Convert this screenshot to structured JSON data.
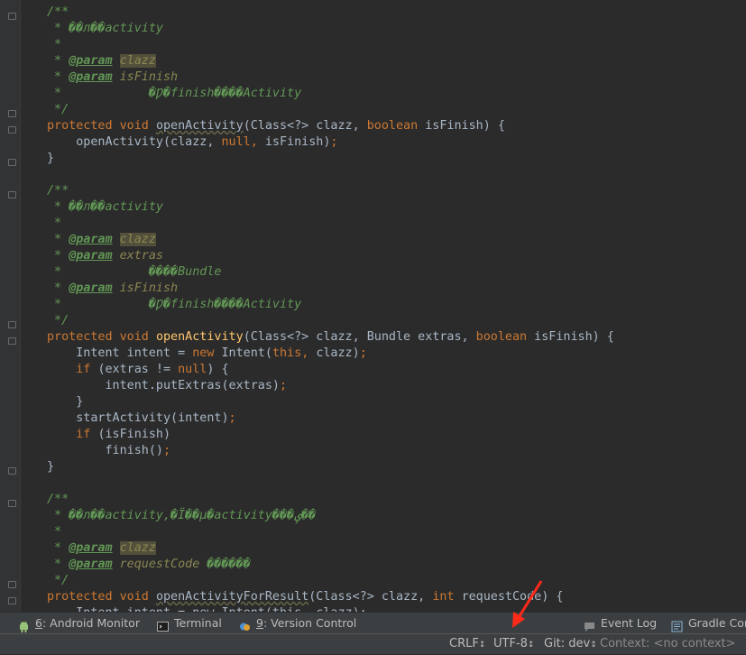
{
  "code_lines": [
    [
      [
        "doc",
        "/**"
      ]
    ],
    [
      [
        "doc",
        " * ��л��activity"
      ]
    ],
    [
      [
        "doc",
        " *"
      ]
    ],
    [
      [
        "doc",
        " * "
      ],
      [
        "tag",
        "@param"
      ],
      [
        "doc",
        " "
      ],
      [
        "hl",
        "clazz"
      ]
    ],
    [
      [
        "doc",
        " * "
      ],
      [
        "tag",
        "@param"
      ],
      [
        "doc",
        " "
      ],
      [
        "param",
        "isFinish"
      ]
    ],
    [
      [
        "doc",
        " *            �Ƿ�finish����Activity"
      ]
    ],
    [
      [
        "doc",
        " */"
      ]
    ],
    [
      [
        "kw",
        "protected void "
      ],
      [
        "fnu",
        "openActivity"
      ],
      [
        "txt",
        "(Class<?> clazz, "
      ],
      [
        "kw",
        "boolean "
      ],
      [
        "txt",
        "isFinish) {"
      ]
    ],
    [
      [
        "txt",
        "    openActivity(clazz, "
      ],
      [
        "kw",
        "null"
      ],
      [
        "punct",
        ", "
      ],
      [
        "txt",
        "isFinish)"
      ],
      [
        "punct",
        ";"
      ]
    ],
    [
      [
        "txt",
        "}"
      ]
    ],
    [
      [
        "txt",
        ""
      ]
    ],
    [
      [
        "doc",
        "/**"
      ]
    ],
    [
      [
        "doc",
        " * ��л��activity"
      ]
    ],
    [
      [
        "doc",
        " *"
      ]
    ],
    [
      [
        "doc",
        " * "
      ],
      [
        "tag",
        "@param"
      ],
      [
        "doc",
        " "
      ],
      [
        "hl",
        "clazz"
      ]
    ],
    [
      [
        "doc",
        " * "
      ],
      [
        "tag",
        "@param"
      ],
      [
        "doc",
        " "
      ],
      [
        "param",
        "extras"
      ]
    ],
    [
      [
        "doc",
        " *            ����Bundle"
      ]
    ],
    [
      [
        "doc",
        " * "
      ],
      [
        "tag",
        "@param"
      ],
      [
        "doc",
        " "
      ],
      [
        "param",
        "isFinish"
      ]
    ],
    [
      [
        "doc",
        " *            �Ƿ�finish����Activity"
      ]
    ],
    [
      [
        "doc",
        " */"
      ]
    ],
    [
      [
        "kw",
        "protected void "
      ],
      [
        "fn",
        "openActivity"
      ],
      [
        "txt",
        "(Class<?> clazz, Bundle extras, "
      ],
      [
        "kw",
        "boolean "
      ],
      [
        "txt",
        "isFinish) {"
      ]
    ],
    [
      [
        "txt",
        "    Intent intent = "
      ],
      [
        "kw",
        "new "
      ],
      [
        "txt",
        "Intent("
      ],
      [
        "kw",
        "this"
      ],
      [
        "punct",
        ", "
      ],
      [
        "txt",
        "clazz)"
      ],
      [
        "punct",
        ";"
      ]
    ],
    [
      [
        "txt",
        "    "
      ],
      [
        "kw",
        "if "
      ],
      [
        "txt",
        "(extras != "
      ],
      [
        "kw",
        "null"
      ],
      [
        "txt",
        ") {"
      ]
    ],
    [
      [
        "txt",
        "        intent.putExtras(extras)"
      ],
      [
        "punct",
        ";"
      ]
    ],
    [
      [
        "txt",
        "    }"
      ]
    ],
    [
      [
        "txt",
        "    startActivity(intent)"
      ],
      [
        "punct",
        ";"
      ]
    ],
    [
      [
        "txt",
        "    "
      ],
      [
        "kw",
        "if "
      ],
      [
        "txt",
        "(isFinish)"
      ]
    ],
    [
      [
        "txt",
        "        finish()"
      ],
      [
        "punct",
        ";"
      ]
    ],
    [
      [
        "txt",
        "}"
      ]
    ],
    [
      [
        "txt",
        ""
      ]
    ],
    [
      [
        "doc",
        "/**"
      ]
    ],
    [
      [
        "doc",
        " * ��л��activity,�Ϊ��µ�activity���ݷ��"
      ]
    ],
    [
      [
        "doc",
        " *"
      ]
    ],
    [
      [
        "doc",
        " * "
      ],
      [
        "tag",
        "@param"
      ],
      [
        "doc",
        " "
      ],
      [
        "hl",
        "clazz"
      ]
    ],
    [
      [
        "doc",
        " * "
      ],
      [
        "tag",
        "@param"
      ],
      [
        "doc",
        " "
      ],
      [
        "param",
        "requestCode"
      ],
      [
        "doc",
        " ������"
      ]
    ],
    [
      [
        "doc",
        " */"
      ]
    ],
    [
      [
        "kw",
        "protected void "
      ],
      [
        "fnu",
        "openActivityForResult"
      ],
      [
        "txt",
        "(Class<?> clazz, "
      ],
      [
        "kw",
        "int "
      ],
      [
        "txt",
        "requestCode) {"
      ]
    ],
    [
      [
        "txt",
        "    Intent intent = new Intent(this, clazz);"
      ]
    ]
  ],
  "tool_windows": [
    {
      "num": "6",
      "label": ": Android Monitor",
      "icon": "android-icon"
    },
    {
      "num": "",
      "label": "Terminal",
      "icon": "terminal-icon"
    },
    {
      "num": "9",
      "label": ": Version Control",
      "icon": "version-control-icon"
    },
    {
      "num": "",
      "label": "Event Log",
      "icon": "event-log-icon"
    },
    {
      "num": "",
      "label": "Gradle Con",
      "icon": "gradle-icon"
    }
  ],
  "status": {
    "line_separator": "CRLF",
    "encoding": "UTF-8",
    "git_branch": "Git: dev",
    "context": "Context: <no context>"
  },
  "colors": {
    "editor_bg": "#2b2b2b",
    "keyword": "#cc7832",
    "doc_comment": "#629755",
    "function": "#ffc66d",
    "annotation_arrow": "#ff2a1a"
  }
}
